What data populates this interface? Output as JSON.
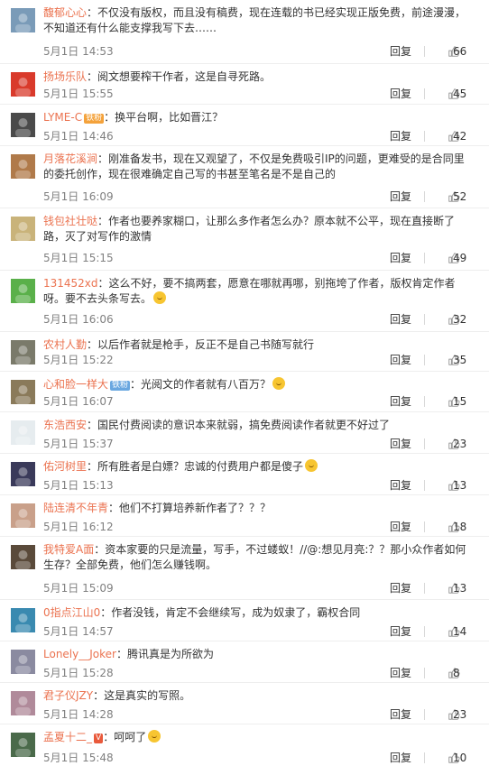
{
  "action_labels": {
    "reply": "回复"
  },
  "comments": [
    {
      "user": "馥郁心心",
      "text": "：不仅没有版权，而且没有稿费，现在连载的书已经实现正版免费，前途漫漫，不知道还有什么能支撑我写下去……",
      "time": "5月1日 14:53",
      "likes": "66",
      "avatar_color": "#7a9bb8"
    },
    {
      "user": "扬场乐队",
      "text": "：阅文想要榨干作者，这是自寻死路。",
      "time": "5月1日 15:55",
      "likes": "45",
      "avatar_color": "#d93a2b"
    },
    {
      "user": "LYME-C",
      "badge_text": "铁粉",
      "text": "：换平台啊，比如晋江？",
      "time": "5月1日 14:46",
      "likes": "42",
      "avatar_color": "#4a4a4a"
    },
    {
      "user": "月落花溪涧",
      "text": "：刚准备发书，现在又观望了，不仅是免费吸引IP的问题，更难受的是合同里的委托创作，现在很难确定自己写的书甚至笔名是不是自己的",
      "time": "5月1日 16:09",
      "likes": "52",
      "avatar_color": "#b07a4a"
    },
    {
      "user": "钱包社壮哒",
      "text": "：作者也要养家糊口，让那么多作者怎么办？原本就不公平，现在直接断了路，灭了对写作的激情",
      "time": "5月1日 15:15",
      "likes": "49",
      "avatar_color": "#c9b37a"
    },
    {
      "user": "131452xd",
      "text": "：这么不好，要不搞两套，愿意在哪就再哪，别拖垮了作者，版权肯定作者呀。要不去头条写去。",
      "time": "5月1日 16:06",
      "likes": "32",
      "avatar_color": "#5ab04a"
    },
    {
      "user": "农村人勤",
      "text": "：以后作者就是枪手，反正不是自己书随写就行",
      "time": "5月1日 15:22",
      "likes": "35",
      "avatar_color": "#7a7a6a"
    },
    {
      "user": "心和脸一样大",
      "badge_text": "铁粉",
      "text": "：光阅文的作者就有八百万？",
      "time": "5月1日 16:07",
      "likes": "15",
      "avatar_color": "#8a7a5a"
    },
    {
      "user": "东浩西安",
      "text": "：国民付费阅读的意识本来就弱，搞免费阅读作者就更不好过了",
      "time": "5月1日 15:37",
      "likes": "23",
      "avatar_color": "#e6ecef"
    },
    {
      "user": "佑河树里",
      "text": "：所有胜者是白嫖？忠诚的付费用户都是傻子",
      "time": "5月1日 15:13",
      "likes": "13",
      "avatar_color": "#3a3a5a"
    },
    {
      "user": "陆连清不年青",
      "text": "：他们不打算培养新作者了？？？",
      "time": "5月1日 16:12",
      "likes": "18",
      "avatar_color": "#c9a08a"
    },
    {
      "user": "我特爱A面",
      "text": "：资本家要的只是流量，写手，不过蝼蚁！//@:想见月亮:？？那小众作者如何生存？全部免费，他们怎么赚钱啊。",
      "time": "5月1日 15:09",
      "likes": "13",
      "avatar_color": "#5a4a3a"
    },
    {
      "user": "0指点江山0",
      "text": "：作者没钱，肯定不会继续写，成为奴隶了，霸权合同",
      "time": "5月1日 14:57",
      "likes": "14",
      "avatar_color": "#3a8ab0"
    },
    {
      "user": "Lonely__Joker",
      "text": "：腾讯真是为所欲为",
      "time": "5月1日 15:28",
      "likes": "8",
      "avatar_color": "#8a8aa0"
    },
    {
      "user": "君子仪JZY",
      "text": "：这是真实的写照。",
      "time": "5月1日 14:28",
      "likes": "23",
      "avatar_color": "#b08a9a"
    },
    {
      "user": "孟夏十二_",
      "badge_text": "V",
      "text": "：呵呵了",
      "time": "5月1日 15:48",
      "likes": "10",
      "avatar_color": "#4a6a4a"
    }
  ]
}
